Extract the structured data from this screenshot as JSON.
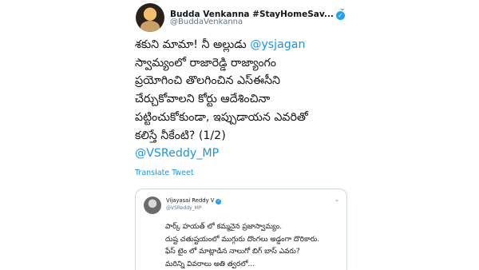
{
  "tweet": {
    "display_name": "Budda Venkanna #StayHomeSav...",
    "handle": "@BuddaVenkanna",
    "body_lines": [
      {
        "pre": "శకుని మామా! నీ అల్లుడు ",
        "mention": "@ysjagan"
      },
      {
        "pre": "స్వామ్యంలో రాజారెడ్డి రాజ్యాంగం"
      },
      {
        "pre": "ప్రయోగించి తొలగించిన ఎస్ఈసీని"
      },
      {
        "pre": "చేర్చుకోవాలని కోర్టు ఆదేశించినా"
      },
      {
        "pre": "పట్టించుకోకుండా, ఇప్పుడాయన ఎవరితో"
      },
      {
        "pre": "కలిస్తే నీకేంటి? (1/2)"
      },
      {
        "pre": "",
        "mention": "@VSReddy_MP"
      }
    ],
    "translate_label": "Translate Tweet"
  },
  "quoted": {
    "display_name": "Vijayasai Reddy V",
    "handle": "@VSReddy_MP",
    "body_lines": [
      "పార్క్ హయత్ లో కమ్మనైన ప్రజాస్వామ్యం.",
      "దుష్ట చతుష్టయంలో ముగ్గురు దొంగలు అడ్డంగా దొరికారు.",
      "ఫేస్ టైం లో మాట్లాడిన నాలుగో బిగ్ బాస్ ఎవరు?",
      "మరిన్ని వివరాలు అతి త్వరలో..."
    ]
  },
  "colors": {
    "link": "#1b95e0",
    "verified": "#1da1f2",
    "text": "#14171a",
    "muted": "#657786"
  },
  "icons": {
    "verified": "verified-badge-icon",
    "more": "chevron-down-icon"
  }
}
